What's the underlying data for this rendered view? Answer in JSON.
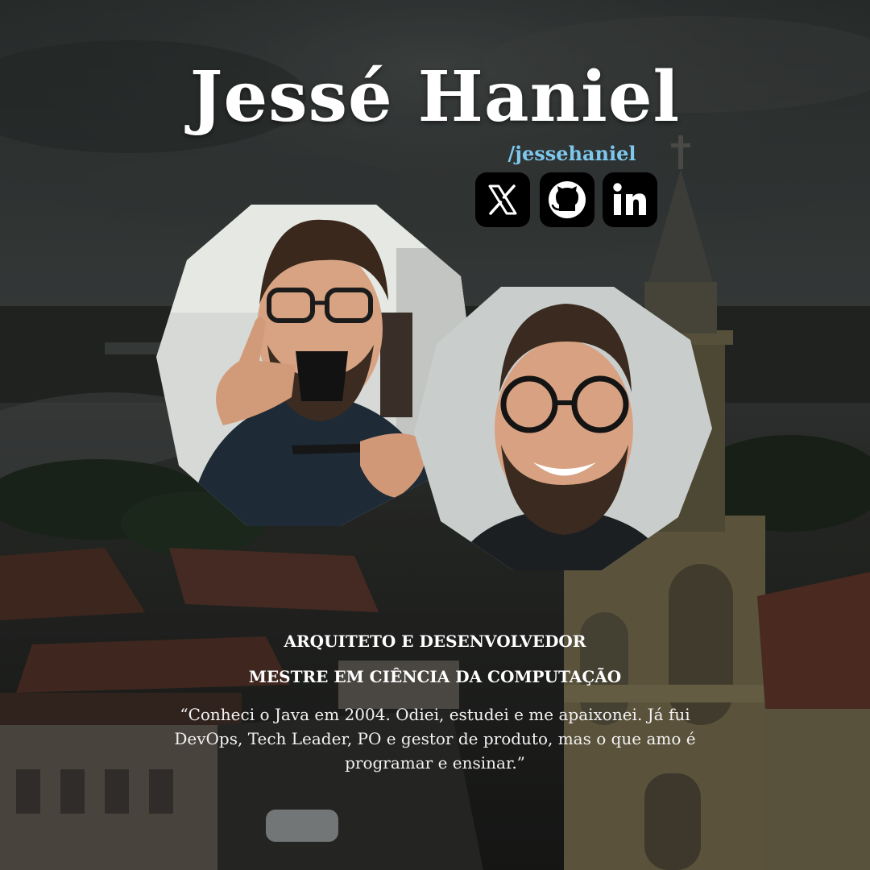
{
  "profile": {
    "name": "Jessé Haniel",
    "handle": "/jessehaniel",
    "roles": [
      "ARQUITETO E DESENVOLVEDOR",
      "MESTRE EM CIÊNCIA DA COMPUTAÇÃO"
    ],
    "quote": "“Conheci o Java em 2004. Odiei, estudei e me apaixonei. Já fui DevOps, Tech Leader,  PO e gestor de produto, mas o que amo é programar e ensinar.”"
  },
  "social": [
    {
      "icon": "x-icon"
    },
    {
      "icon": "github-icon"
    },
    {
      "icon": "linkedin-icon"
    }
  ],
  "colors": {
    "handle": "#7ec8ee",
    "social_bg": "#000000",
    "title": "#ffffff"
  }
}
